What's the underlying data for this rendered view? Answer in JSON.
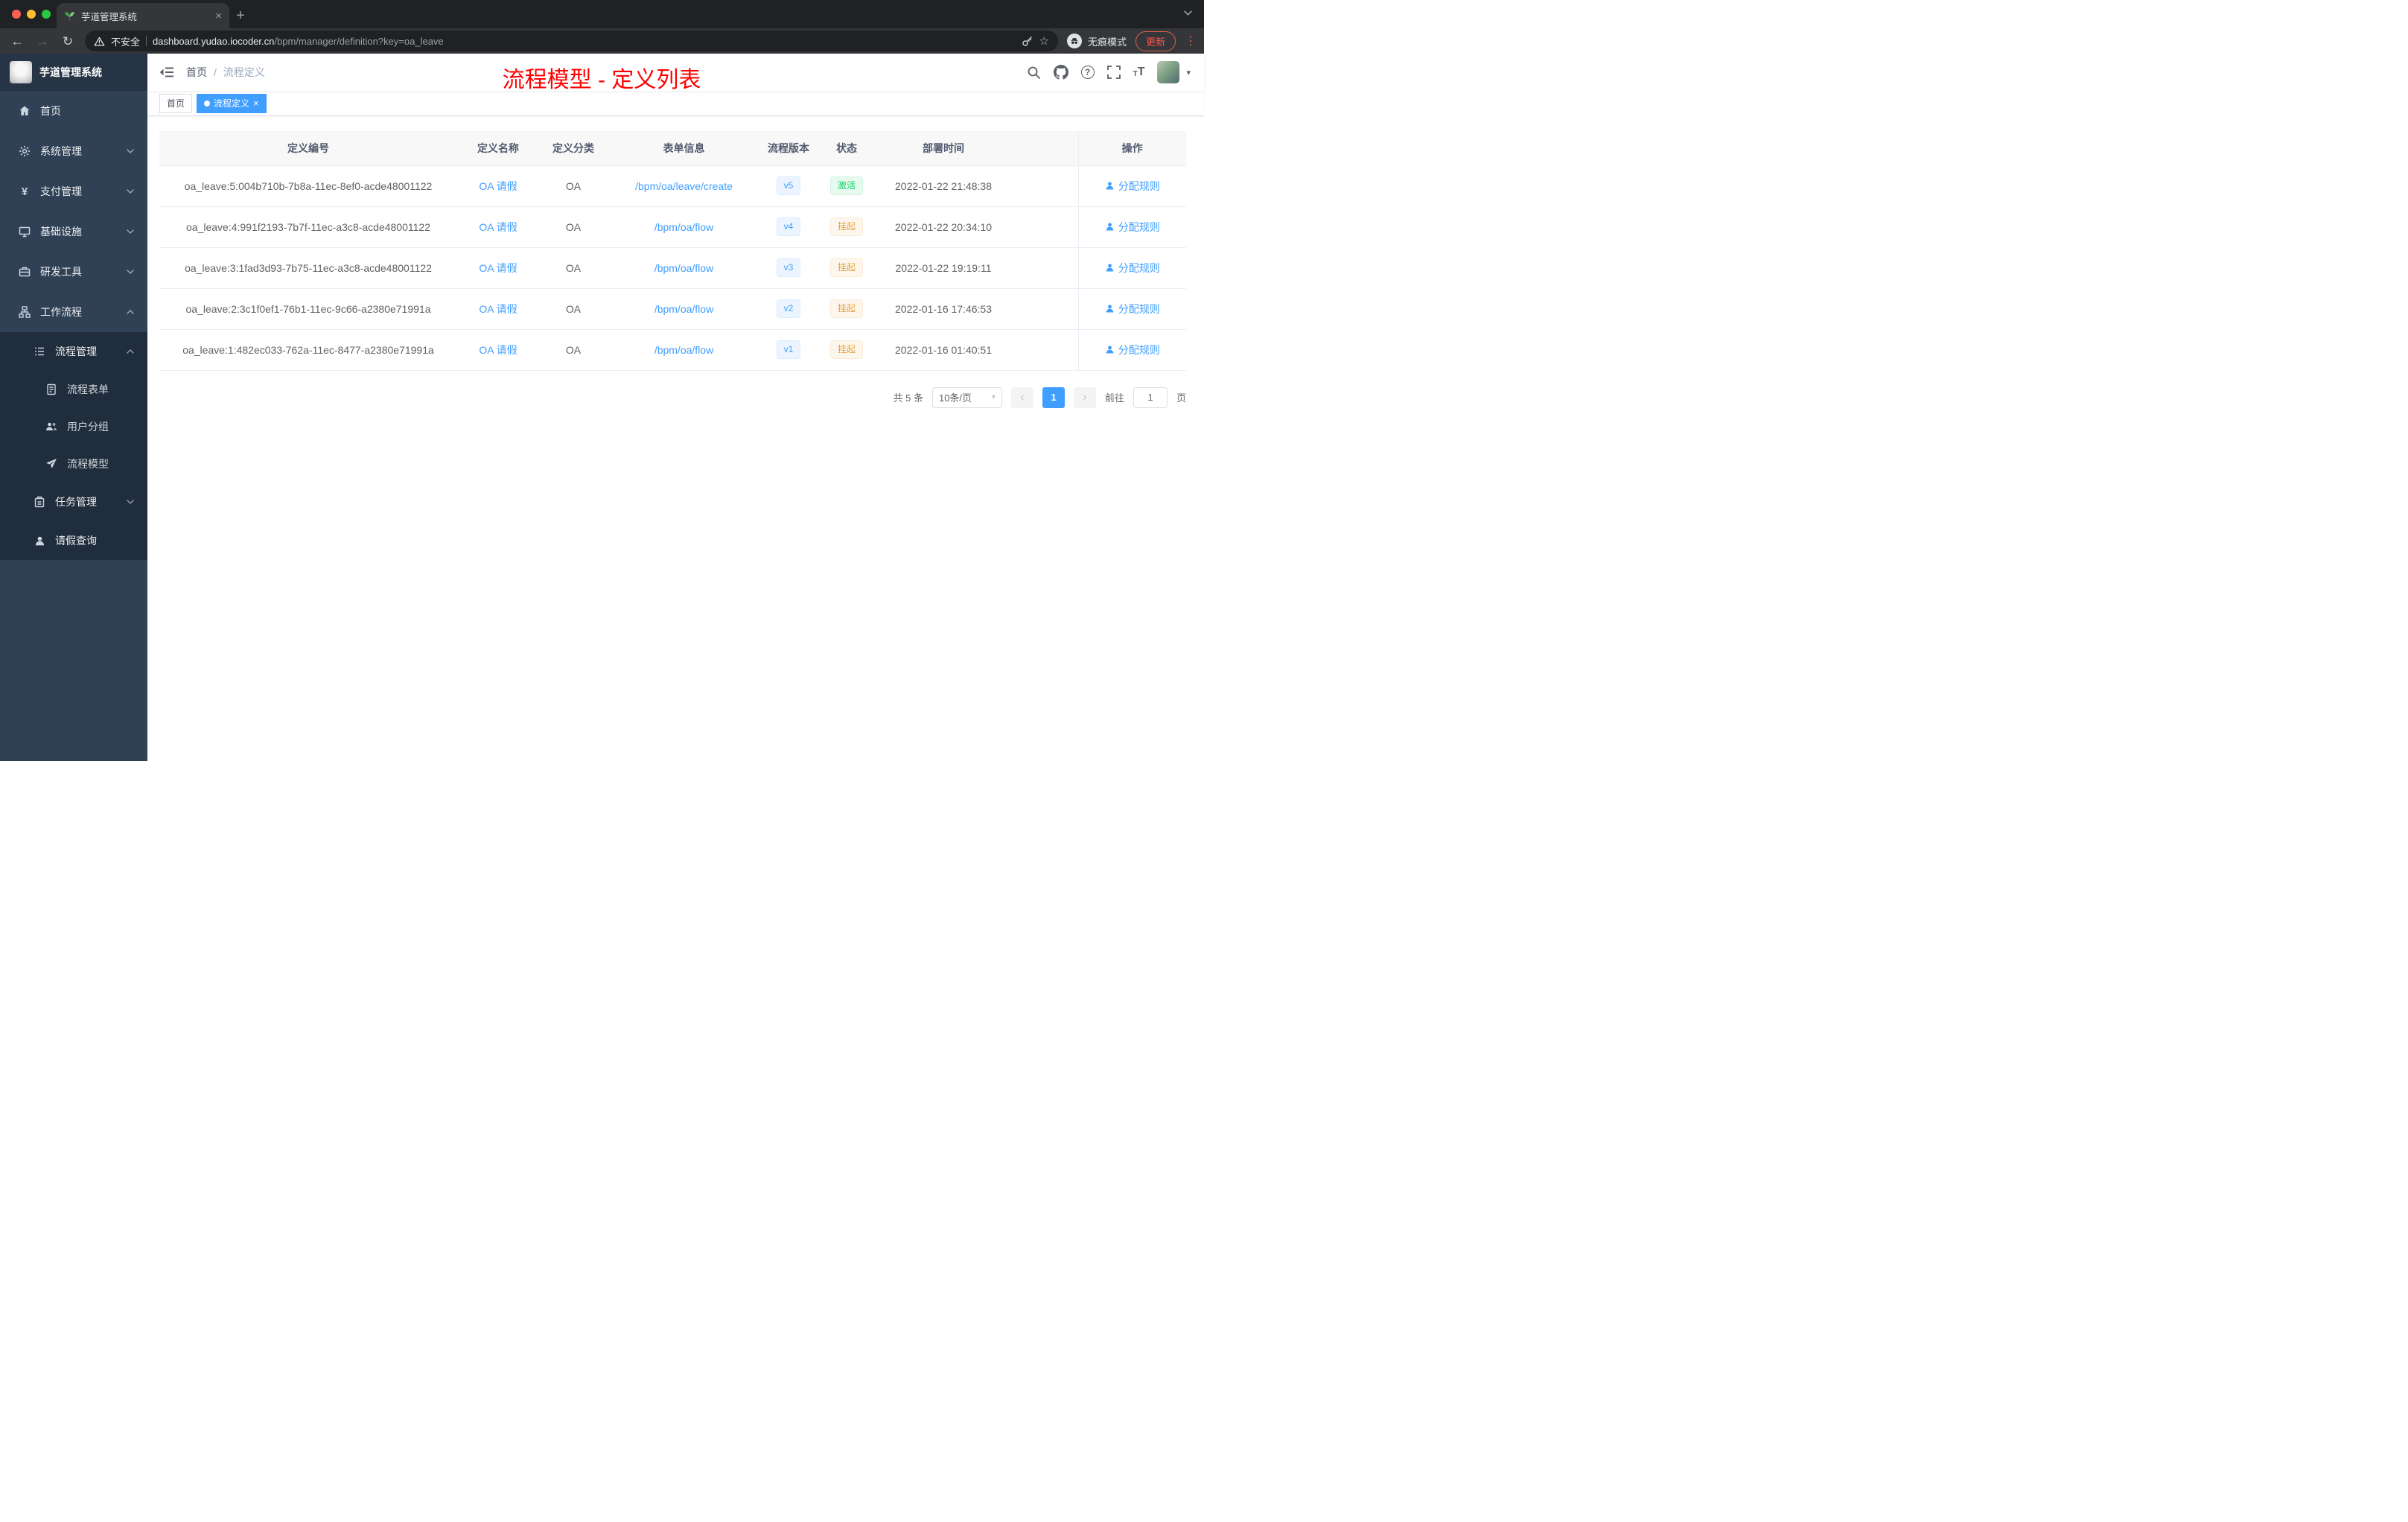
{
  "colors": {
    "accent": "#409eff",
    "annotation_red": "#ff0000",
    "status_active_green": "#13ce66",
    "status_suspended_orange": "#e6a23c",
    "sidebar_bg": "#304156",
    "submenu_bg": "#1f2d3d"
  },
  "icons": {
    "back": "←",
    "forward": "→",
    "reload": "↻",
    "star": "☆",
    "more_vertical": "⋮",
    "caret_down": "▾",
    "close": "×",
    "plus": "+",
    "yen": "¥",
    "question": "?",
    "prev": "‹",
    "next": "›",
    "text_size_small": "T",
    "text_size_large": "T"
  },
  "browser": {
    "tab_title": "芋道管理系统",
    "security_label": "不安全",
    "url_domain": "dashboard.yudao.iocoder.cn",
    "url_path": "/bpm/manager/definition?key=oa_leave",
    "incognito_label": "无痕模式",
    "update_label": "更新"
  },
  "sidebar": {
    "logo_title": "芋道管理系统",
    "items": [
      {
        "label": "首页"
      },
      {
        "label": "系统管理"
      },
      {
        "label": "支付管理"
      },
      {
        "label": "基础设施"
      },
      {
        "label": "研发工具"
      },
      {
        "label": "工作流程"
      }
    ],
    "submenu": [
      {
        "label": "流程管理"
      },
      {
        "label": "流程表单"
      },
      {
        "label": "用户分组"
      },
      {
        "label": "流程模型"
      },
      {
        "label": "任务管理"
      },
      {
        "label": "请假查询"
      }
    ]
  },
  "header": {
    "breadcrumb_home": "首页",
    "breadcrumb_separator": "/",
    "breadcrumb_current": "流程定义",
    "overlay_title": "流程模型 - 定义列表"
  },
  "tags": {
    "home": "首页",
    "active": "流程定义"
  },
  "table": {
    "columns": [
      "定义编号",
      "定义名称",
      "定义分类",
      "表单信息",
      "流程版本",
      "状态",
      "部署时间",
      "操作"
    ],
    "rows": [
      {
        "id": "oa_leave:5:004b710b-7b8a-11ec-8ef0-acde48001122",
        "name": "OA 请假",
        "category": "OA",
        "form": "/bpm/oa/leave/create",
        "version": "v5",
        "status_label": "激活",
        "status_type": "active",
        "deploy_time": "2022-01-22 21:48:38",
        "action": "分配规则"
      },
      {
        "id": "oa_leave:4:991f2193-7b7f-11ec-a3c8-acde48001122",
        "name": "OA 请假",
        "category": "OA",
        "form": "/bpm/oa/flow",
        "version": "v4",
        "status_label": "挂起",
        "status_type": "suspended",
        "deploy_time": "2022-01-22 20:34:10",
        "action": "分配规则"
      },
      {
        "id": "oa_leave:3:1fad3d93-7b75-11ec-a3c8-acde48001122",
        "name": "OA 请假",
        "category": "OA",
        "form": "/bpm/oa/flow",
        "version": "v3",
        "status_label": "挂起",
        "status_type": "suspended",
        "deploy_time": "2022-01-22 19:19:11",
        "action": "分配规则"
      },
      {
        "id": "oa_leave:2:3c1f0ef1-76b1-11ec-9c66-a2380e71991a",
        "name": "OA 请假",
        "category": "OA",
        "form": "/bpm/oa/flow",
        "version": "v2",
        "status_label": "挂起",
        "status_type": "suspended",
        "deploy_time": "2022-01-16 17:46:53",
        "action": "分配规则"
      },
      {
        "id": "oa_leave:1:482ec033-762a-11ec-8477-a2380e71991a",
        "name": "OA 请假",
        "category": "OA",
        "form": "/bpm/oa/flow",
        "version": "v1",
        "status_label": "挂起",
        "status_type": "suspended",
        "deploy_time": "2022-01-16 01:40:51",
        "action": "分配规则"
      }
    ]
  },
  "pagination": {
    "total": "共 5 条",
    "page_size": "10条/页",
    "current_page": "1",
    "goto_label": "前往",
    "goto_value": "1",
    "goto_unit": "页"
  }
}
